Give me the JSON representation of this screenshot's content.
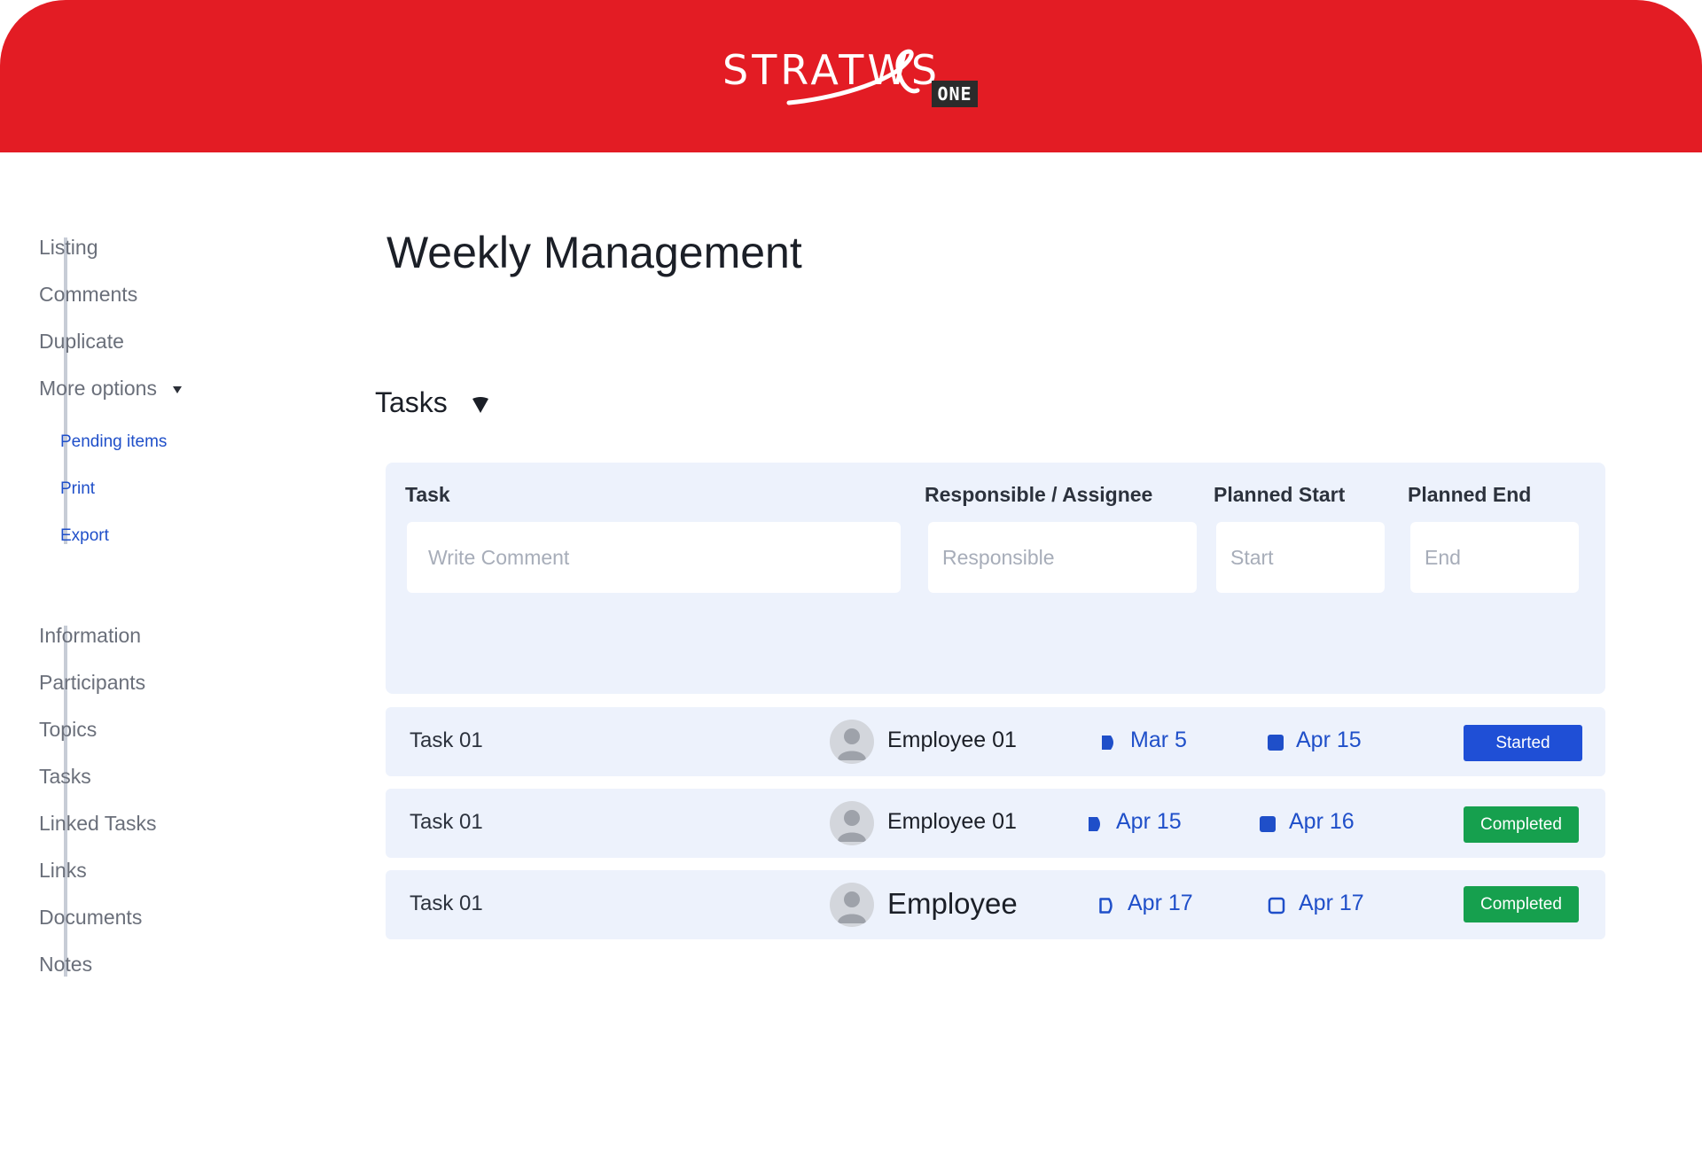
{
  "brand": {
    "logo_text": "STRATWS",
    "logo_badge": "ONE",
    "header_color": "#e31c24"
  },
  "sidebar": {
    "group1": [
      {
        "label": "Listing"
      },
      {
        "label": "Comments"
      },
      {
        "label": "Duplicate"
      },
      {
        "label": "More options",
        "icon": "caret-down-icon"
      }
    ],
    "sub_items": [
      {
        "label": "Pending items"
      },
      {
        "label": "Print"
      },
      {
        "label": "Export"
      }
    ],
    "group2": [
      {
        "label": "Information"
      },
      {
        "label": "Participants"
      },
      {
        "label": "Topics"
      },
      {
        "label": "Tasks"
      },
      {
        "label": "Linked Tasks"
      },
      {
        "label": "Links"
      },
      {
        "label": "Documents"
      },
      {
        "label": "Notes"
      }
    ]
  },
  "main": {
    "title": "Weekly Management",
    "section_title": "Tasks",
    "section_icon": "dropdown-caret-icon"
  },
  "filters": {
    "columns": [
      "Task",
      "Responsible / Assignee",
      "Planned Start",
      "Planned End"
    ],
    "task_placeholder": "Write Comment",
    "responsible_placeholder": "Responsible",
    "start_placeholder": "Start",
    "end_placeholder": "End"
  },
  "tasks": [
    {
      "name": "Task 01",
      "assignee": "Employee 01",
      "start": "Mar 5",
      "end": "Apr 15",
      "status": "Started",
      "status_color": "#1f4fd6",
      "start_icon": "play-filled-icon",
      "end_icon": "stop-filled-icon"
    },
    {
      "name": "Task 01",
      "assignee": "Employee 01",
      "start": "Apr 15",
      "end": "Apr 16",
      "status": "Completed",
      "status_color": "#16a04e",
      "start_icon": "play-filled-icon",
      "end_icon": "stop-filled-icon"
    },
    {
      "name": "Task 01",
      "assignee": "Employee",
      "start": "Apr 17",
      "end": "Apr 17",
      "status": "Completed",
      "status_color": "#16a04e",
      "start_icon": "play-outline-icon",
      "end_icon": "stop-outline-icon"
    }
  ],
  "colors": {
    "accent_blue": "#1f4fc9",
    "panel_bg": "#edf2fc",
    "completed_green": "#16a04e",
    "started_blue": "#1f4fd6"
  }
}
